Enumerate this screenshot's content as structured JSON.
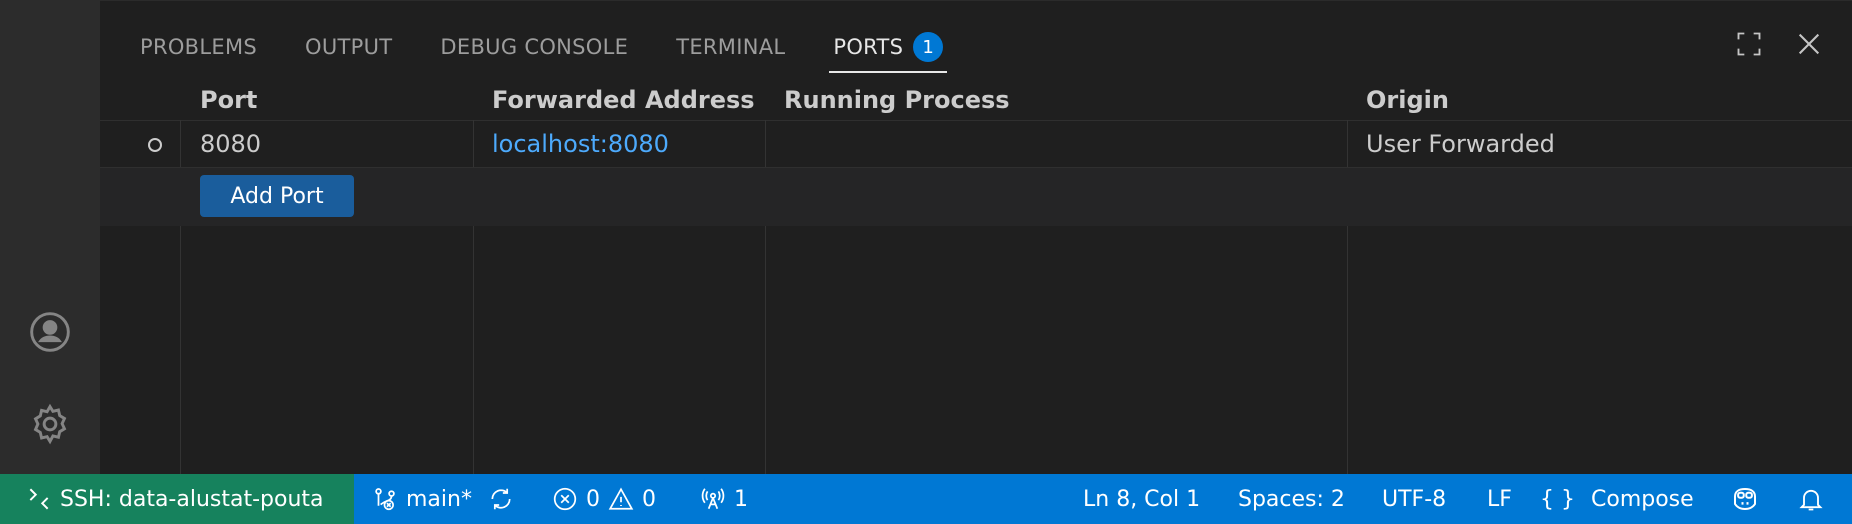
{
  "panel": {
    "tabs": [
      {
        "label": "PROBLEMS"
      },
      {
        "label": "OUTPUT"
      },
      {
        "label": "DEBUG CONSOLE"
      },
      {
        "label": "TERMINAL"
      },
      {
        "label": "PORTS",
        "badge": "1",
        "active": true
      }
    ]
  },
  "ports_table": {
    "columns": [
      "Port",
      "Forwarded Address",
      "Running Process",
      "Origin"
    ],
    "rows": [
      {
        "port": "8080",
        "address": "localhost:8080",
        "process": "",
        "origin": "User Forwarded"
      }
    ],
    "add_port_label": "Add Port"
  },
  "statusbar": {
    "remote": "SSH: data-alustat-pouta",
    "branch": "main*",
    "errors": "0",
    "warnings": "0",
    "ports": "1",
    "cursor": "Ln 8, Col 1",
    "spaces": "Spaces: 2",
    "encoding": "UTF-8",
    "eol": "LF",
    "language_icon": "{ }",
    "language": "Compose"
  },
  "icons": {
    "activity": [
      "account-icon",
      "gear-icon"
    ],
    "panel_actions": [
      "maximize-icon",
      "close-icon"
    ]
  },
  "colors": {
    "accent": "#0078d4",
    "remote": "#16825d",
    "link": "#4daafc"
  }
}
